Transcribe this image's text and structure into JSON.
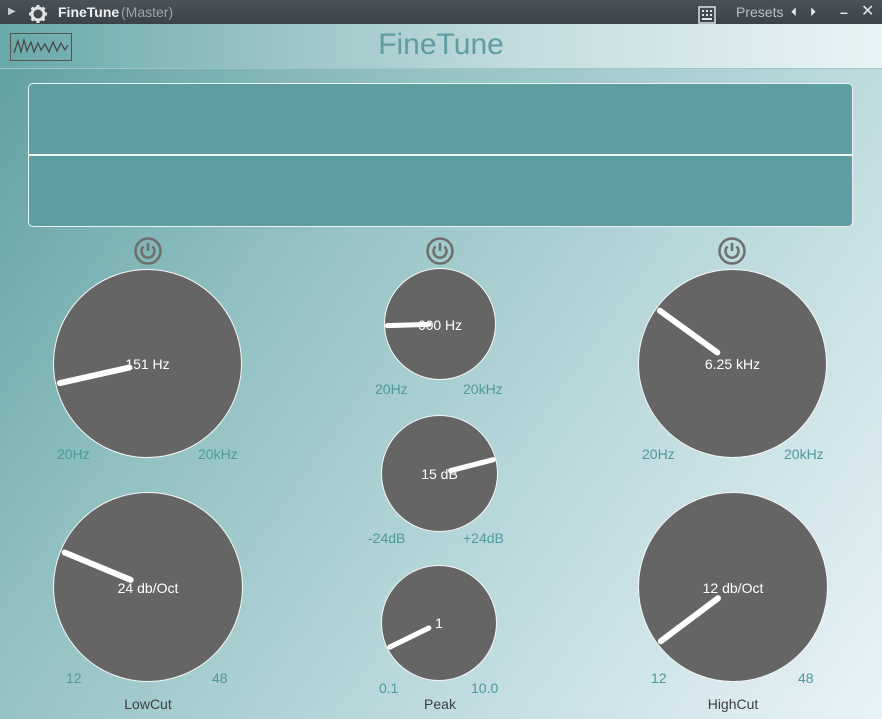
{
  "titlebar": {
    "title": "FineTune",
    "subtitle": "(Master)",
    "presets_label": "Presets",
    "prev": "⏴",
    "next": "⏵",
    "minimize": "–",
    "close": "✕"
  },
  "plugin": {
    "title": "FineTune"
  },
  "lowcut": {
    "freq": {
      "value": "151 Hz",
      "min": "20Hz",
      "max": "20kHz",
      "level": 0.12
    },
    "slope": {
      "value": "24 db/Oct",
      "min": "12",
      "max": "48",
      "level": 0.25
    },
    "label": "LowCut"
  },
  "peak": {
    "freq": {
      "value": "600 Hz",
      "min": "20Hz",
      "max": "20kHz",
      "level": 0.16
    },
    "gain": {
      "value": "15 dB",
      "min": "-24dB",
      "max": "+24dB",
      "level": 0.78
    },
    "q": {
      "value": "1",
      "min": "0.1",
      "max": "10.0",
      "level": 0.07
    },
    "label": "Peak"
  },
  "highcut": {
    "freq": {
      "value": "6.25 kHz",
      "min": "20Hz",
      "max": "20kHz",
      "level": 0.3
    },
    "slope": {
      "value": "12 db/Oct",
      "min": "12",
      "max": "48",
      "level": 0.03
    },
    "label": "HighCut"
  }
}
